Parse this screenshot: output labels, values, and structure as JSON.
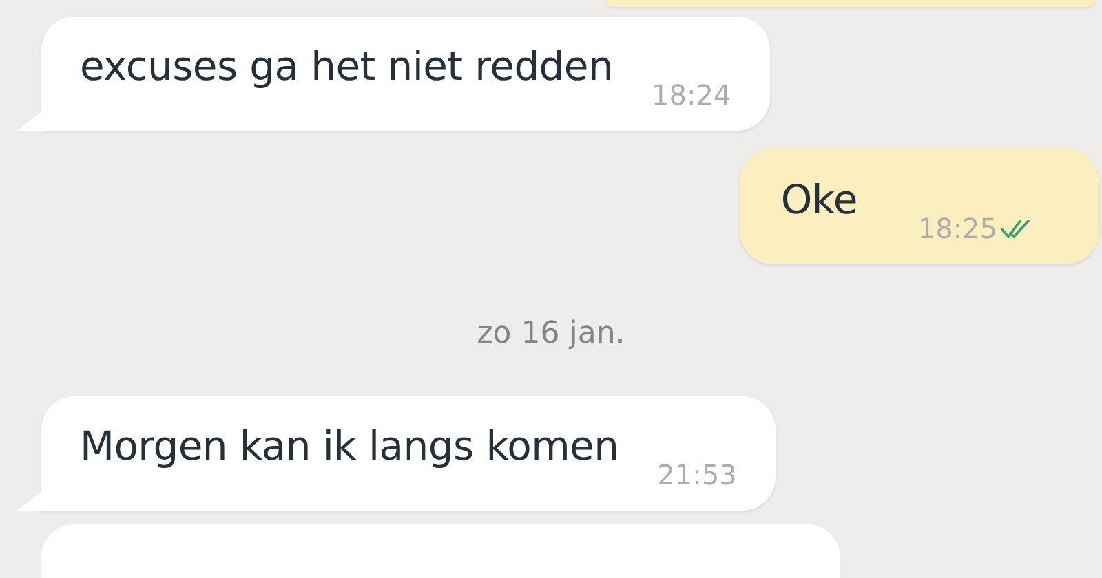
{
  "messages": [
    {
      "kind": "incoming",
      "text": "excuses ga het niet redden",
      "time": "18:24"
    },
    {
      "kind": "outgoing",
      "text": "Oke",
      "time": "18:25",
      "read": true
    },
    {
      "kind": "date",
      "text": "zo 16 jan."
    },
    {
      "kind": "incoming",
      "text": "Morgen kan ik langs komen",
      "time": "21:53"
    }
  ]
}
